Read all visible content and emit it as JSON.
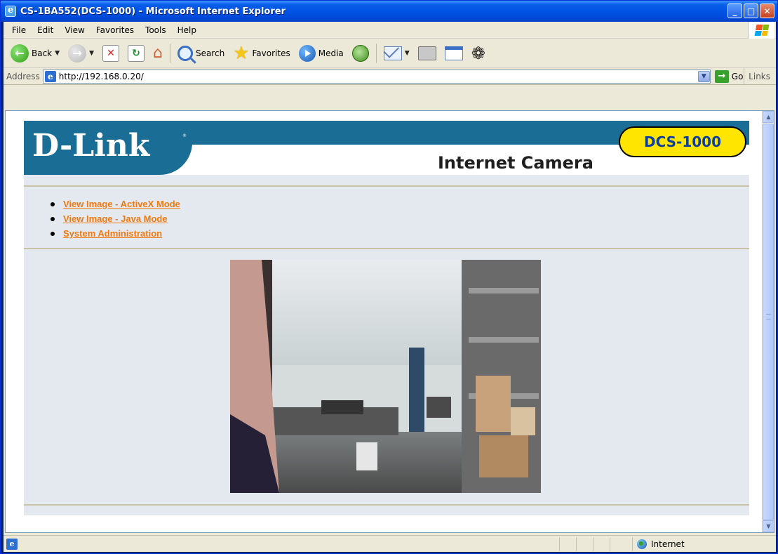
{
  "window": {
    "title": "CS-1BA552(DCS-1000) - Microsoft Internet Explorer"
  },
  "menu": [
    "File",
    "Edit",
    "View",
    "Favorites",
    "Tools",
    "Help"
  ],
  "toolbar": {
    "back_label": "Back",
    "search_label": "Search",
    "favorites_label": "Favorites",
    "media_label": "Media"
  },
  "address": {
    "label": "Address",
    "value": "http://192.168.0.20/",
    "go_label": "Go",
    "links_label": "Links"
  },
  "page": {
    "brand": "D-Link",
    "product": "Internet Camera",
    "model": "DCS-1000",
    "nav": [
      {
        "label": "View Image - ActiveX Mode"
      },
      {
        "label": "View Image - Java Mode"
      },
      {
        "label": "System Administration"
      }
    ]
  },
  "status": {
    "zone": "Internet"
  },
  "colors": {
    "brand_blue": "#1a6d94",
    "link_orange": "#f07a10",
    "badge_yellow": "#ffe500"
  }
}
